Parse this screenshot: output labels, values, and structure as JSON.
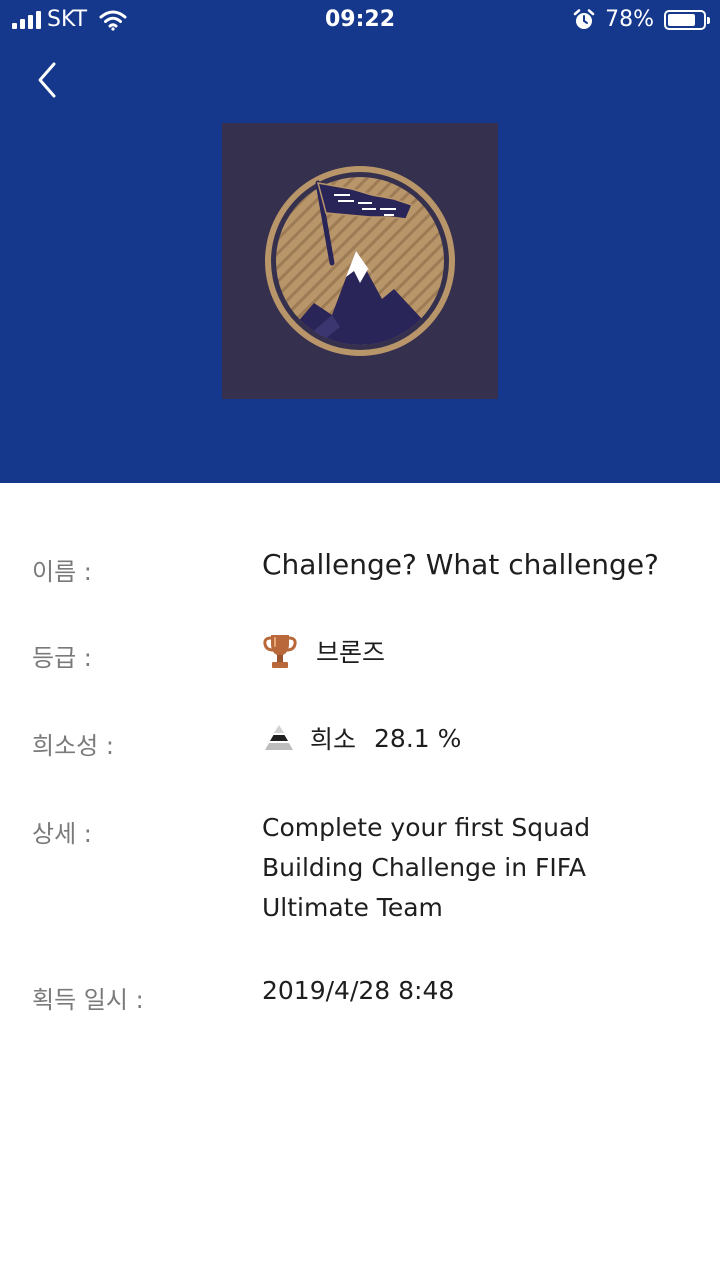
{
  "status_bar": {
    "carrier": "SKT",
    "time": "09:22",
    "battery_text": "78%",
    "battery_level": 0.78
  },
  "colors": {
    "header_bg": "#15378c",
    "badge_bg": "#35304d",
    "badge_gold": "#b9956a"
  },
  "header": {
    "back_icon": "chevron-left-icon",
    "badge_icon": "mountain-flag-badge-icon"
  },
  "details": {
    "name_label": "이름 :",
    "name_value": "Challenge? What challenge?",
    "grade_label": "등급 :",
    "grade_icon": "bronze-trophy-icon",
    "grade_value": "브론즈",
    "rarity_label": "희소성 :",
    "rarity_icon": "rarity-pyramid-icon",
    "rarity_value": "희소",
    "rarity_percent": "28.1 %",
    "detail_label": "상세 :",
    "detail_value": "Complete your first Squad Building Challenge in FIFA Ultimate Team",
    "earned_label": "획득 일시 :",
    "earned_value": "2019/4/28 8:48"
  }
}
